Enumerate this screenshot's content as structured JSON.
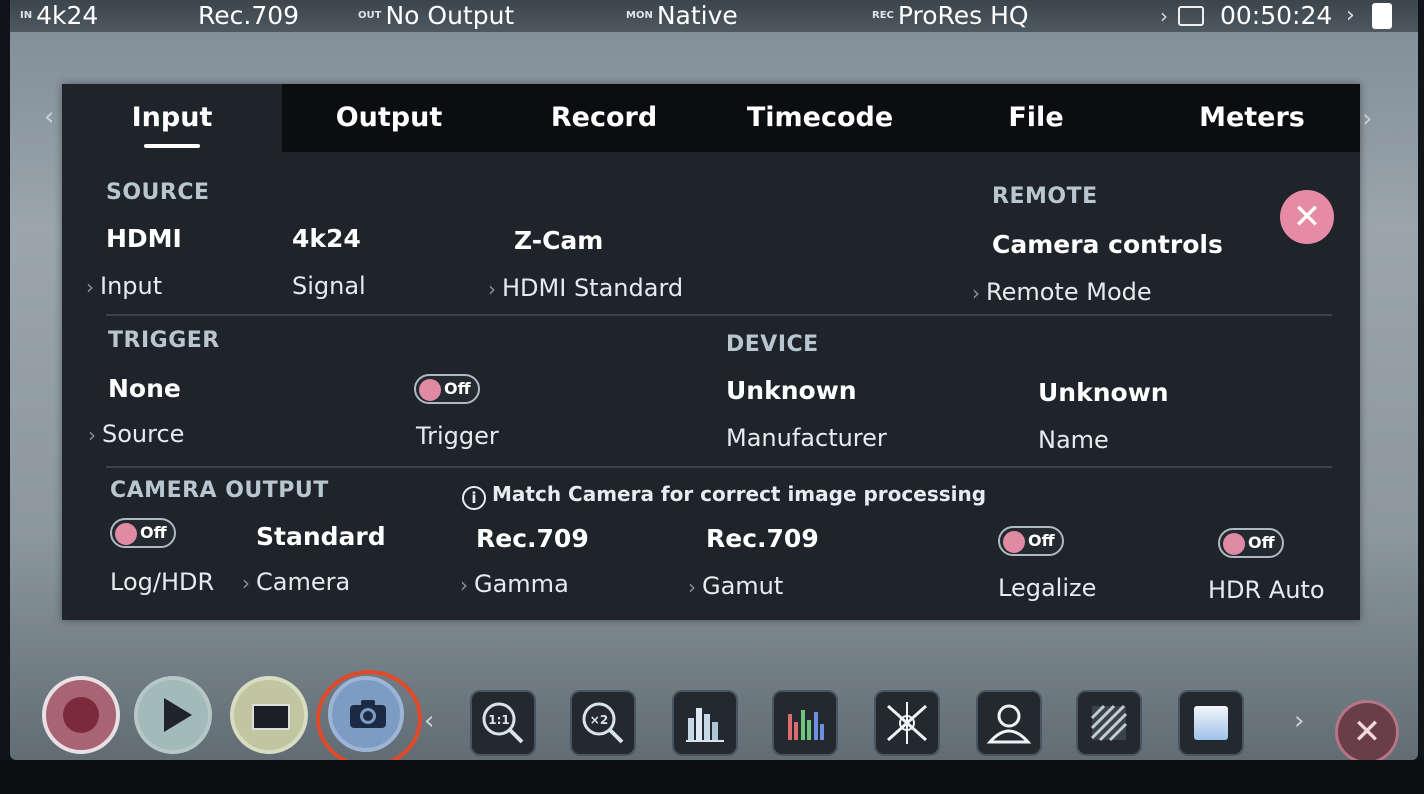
{
  "status_bar": {
    "in_tag": "IN",
    "in_value": "4k24",
    "colorspace": "Rec.709",
    "out_tag": "OUT",
    "out_value": "No Output",
    "mon_tag": "MON",
    "mon_value": "Native",
    "rec_tag": "REC",
    "rec_value": "ProRes HQ",
    "remaining_time": "00:50:24"
  },
  "tabs": [
    {
      "label": "Input",
      "active": true
    },
    {
      "label": "Output"
    },
    {
      "label": "Record"
    },
    {
      "label": "Timecode"
    },
    {
      "label": "File"
    },
    {
      "label": "Meters"
    }
  ],
  "source": {
    "title": "SOURCE",
    "input_value": "HDMI",
    "input_label": "Input",
    "signal_value": "4k24",
    "signal_label": "Signal",
    "standard_value": "Z-Cam",
    "standard_label": "HDMI Standard"
  },
  "remote": {
    "title": "REMOTE",
    "mode_value": "Camera controls",
    "mode_label": "Remote Mode"
  },
  "trigger": {
    "title": "TRIGGER",
    "source_value": "None",
    "source_label": "Source",
    "toggle_text": "Off",
    "toggle_label": "Trigger"
  },
  "device": {
    "title": "DEVICE",
    "manufacturer_value": "Unknown",
    "manufacturer_label": "Manufacturer",
    "name_value": "Unknown",
    "name_label": "Name"
  },
  "camera_output": {
    "title": "CAMERA OUTPUT",
    "info": "Match Camera for correct image processing",
    "log_toggle_text": "Off",
    "log_label": "Log/HDR",
    "camera_value": "Standard",
    "camera_label": "Camera",
    "gamma_value": "Rec.709",
    "gamma_label": "Gamma",
    "gamut_value": "Rec.709",
    "gamut_label": "Gamut",
    "legalize_toggle_text": "Off",
    "legalize_label": "Legalize",
    "hdr_toggle_text": "Off",
    "hdr_label": "HDR Auto"
  },
  "toolbar": {
    "zoom_1_1": "1:1",
    "zoom_x2": "×2"
  }
}
